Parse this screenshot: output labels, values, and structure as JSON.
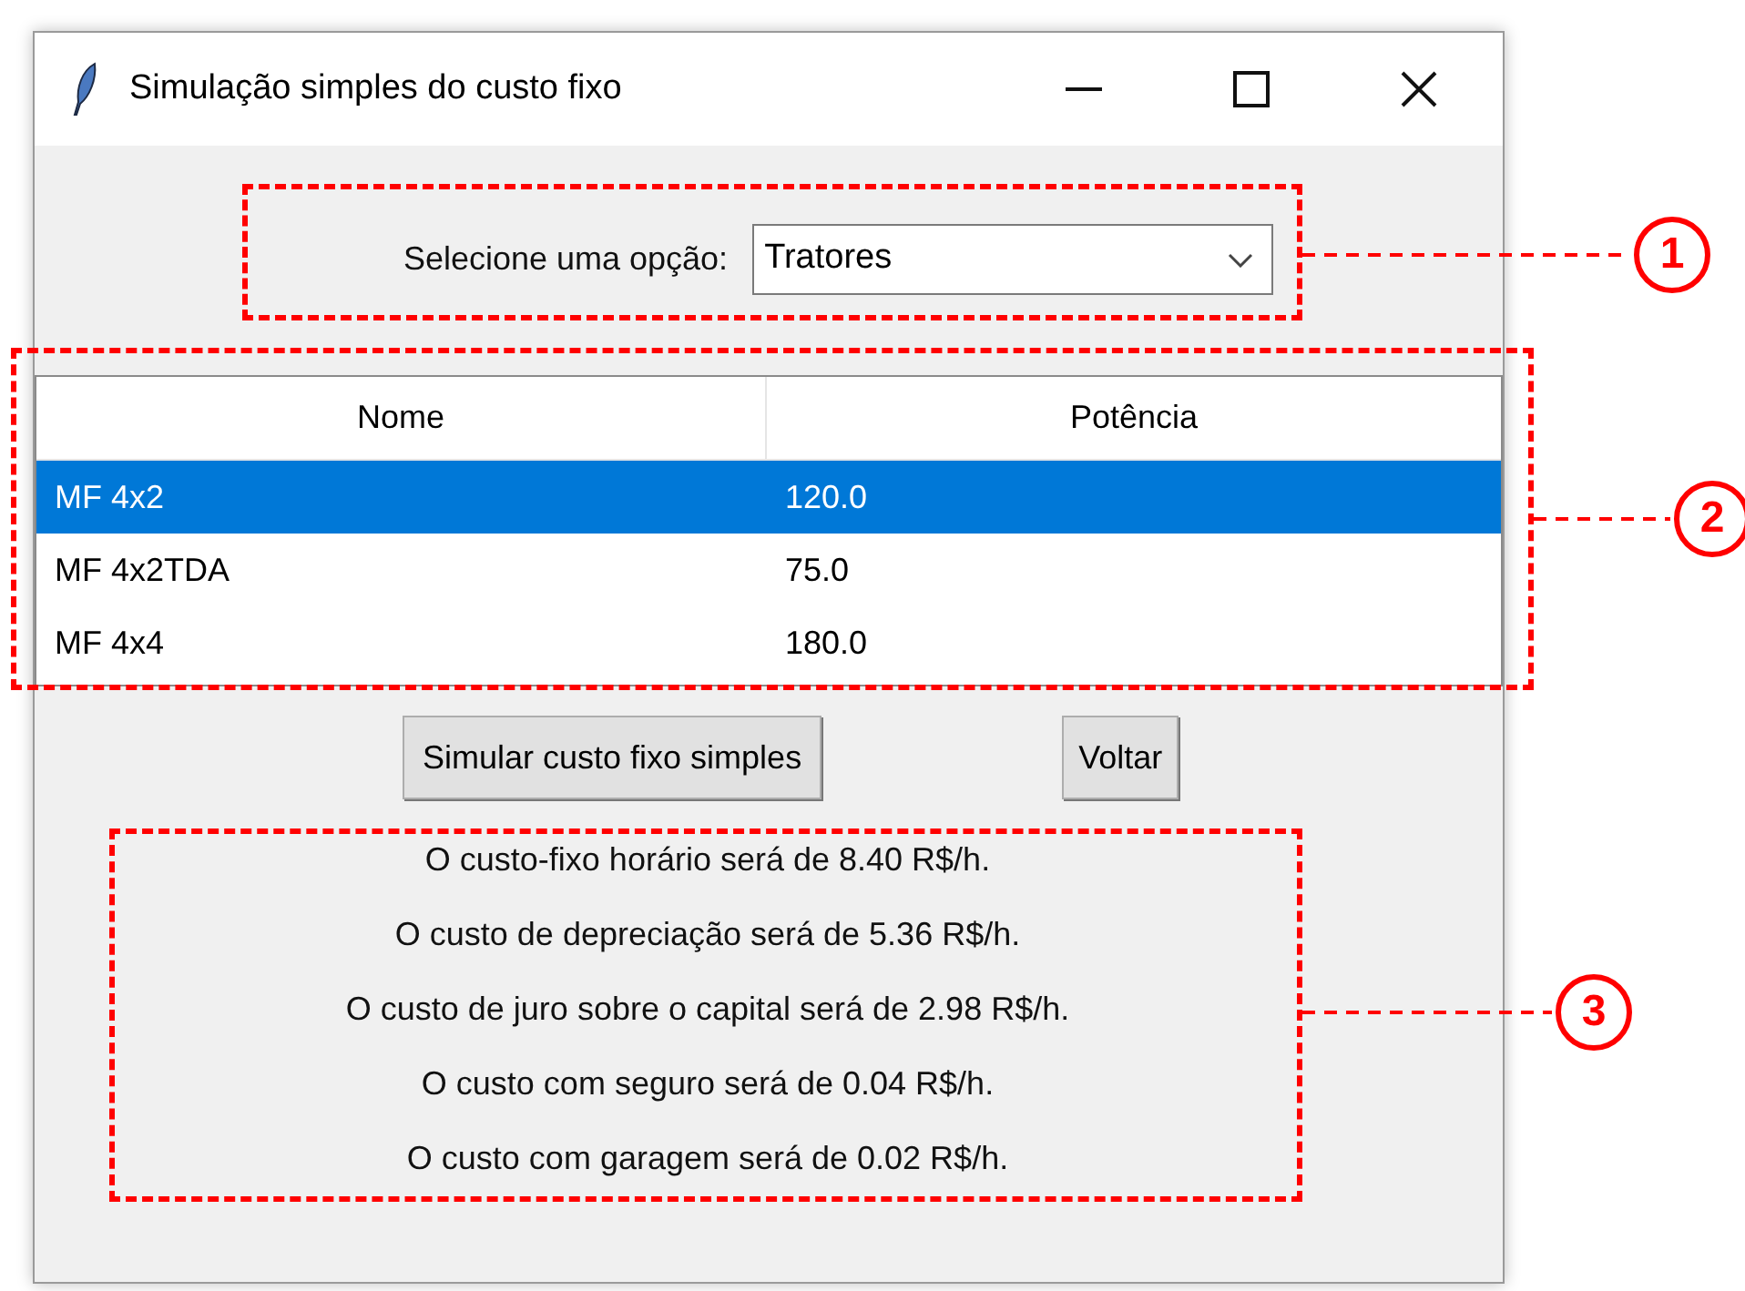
{
  "window": {
    "title": "Simulação simples do custo fixo"
  },
  "selector": {
    "label": "Selecione uma opção:",
    "value": "Tratores"
  },
  "table": {
    "columns": [
      "Nome",
      "Potência"
    ],
    "rows": [
      {
        "cells": [
          "MF 4x2",
          "120.0"
        ],
        "selected": true
      },
      {
        "cells": [
          "MF 4x2TDA",
          "75.0"
        ],
        "selected": false
      },
      {
        "cells": [
          "MF 4x4",
          "180.0"
        ],
        "selected": false
      }
    ]
  },
  "buttons": [
    "Simular custo fixo simples",
    "Voltar"
  ],
  "results": [
    "O custo-fixo horário será de 8.40 R$/h.",
    "O custo de depreciação será de 5.36 R$/h.",
    "O custo de juro sobre o capital será de 2.98 R$/h.",
    "O custo com seguro será de 0.04 R$/h.",
    "O custo com garagem será de 0.02 R$/h."
  ],
  "annotations": [
    {
      "number": "1"
    },
    {
      "number": "2"
    },
    {
      "number": "3"
    }
  ]
}
